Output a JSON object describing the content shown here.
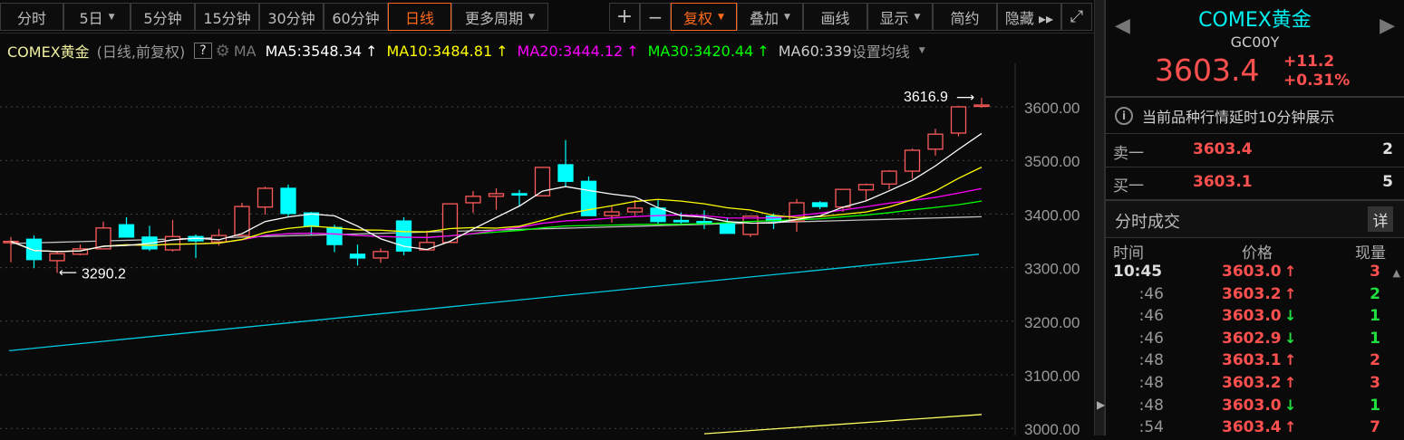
{
  "toolbar": {
    "periods": [
      {
        "label": "分时",
        "caret": false
      },
      {
        "label": "5日",
        "caret": true
      },
      {
        "label": "5分钟",
        "caret": false
      },
      {
        "label": "15分钟",
        "caret": false
      },
      {
        "label": "30分钟",
        "caret": false
      },
      {
        "label": "60分钟",
        "caret": false
      },
      {
        "label": "日线",
        "caret": false,
        "active": true
      },
      {
        "label": "更多周期",
        "caret": true
      }
    ],
    "zoom_in": "+",
    "zoom_out": "−",
    "tools": [
      {
        "label": "复权",
        "caret": true,
        "active": true
      },
      {
        "label": "叠加",
        "caret": true
      },
      {
        "label": "画线",
        "caret": false
      },
      {
        "label": "显示",
        "caret": true
      },
      {
        "label": "简约",
        "caret": false
      },
      {
        "label": "隐藏 ▸▸",
        "caret": false
      }
    ],
    "fullscreen_icon": "expand-icon"
  },
  "info": {
    "name": "COMEX黄金",
    "mode": "(日线,前复权)",
    "help": "?",
    "ma_label": "MA",
    "ma5": "MA5:3548.34",
    "ma10": "MA10:3484.81",
    "ma20": "MA20:3444.12",
    "ma30": "MA30:3420.44",
    "ma60": "MA60:339",
    "arrow": "↑",
    "set_ma": "设置均线"
  },
  "colors": {
    "up": "#ff5a5a",
    "down": "#00ffff",
    "ma5": "#ffffff",
    "ma10": "#ffff00",
    "ma20": "#ff00ff",
    "ma30": "#00ff00",
    "ma60": "#c0c0c0",
    "long1": "#00c8e0",
    "long2": "#ffff60"
  },
  "chart_data": {
    "type": "candlestick",
    "ylim": [
      2980,
      3660
    ],
    "yticks": [
      "3600.00",
      "3500.00",
      "3400.00",
      "3300.00",
      "3200.00",
      "3100.00",
      "3000.00"
    ],
    "ytick_values": [
      3600,
      3500,
      3400,
      3300,
      3200,
      3100,
      3000
    ],
    "high_label": "3616.9",
    "low_label": "3290.2",
    "ohlc": [
      [
        3348,
        3357,
        3310,
        3349
      ],
      [
        3353,
        3360,
        3299,
        3315
      ],
      [
        3313,
        3329,
        3290.2,
        3326
      ],
      [
        3325,
        3343,
        3323,
        3335
      ],
      [
        3335,
        3386,
        3335,
        3374
      ],
      [
        3380,
        3394,
        3357,
        3357
      ],
      [
        3357,
        3378,
        3331,
        3335
      ],
      [
        3333,
        3389,
        3330,
        3358
      ],
      [
        3358,
        3362,
        3318,
        3350
      ],
      [
        3348,
        3372,
        3341,
        3360
      ],
      [
        3360,
        3421,
        3357,
        3414
      ],
      [
        3413,
        3451,
        3399,
        3448
      ],
      [
        3448,
        3455,
        3396,
        3401
      ],
      [
        3402,
        3404,
        3360,
        3377
      ],
      [
        3375,
        3380,
        3329,
        3343
      ],
      [
        3325,
        3343,
        3304,
        3318
      ],
      [
        3318,
        3336,
        3309,
        3330
      ],
      [
        3387,
        3394,
        3323,
        3331
      ],
      [
        3333,
        3369,
        3333,
        3347
      ],
      [
        3347,
        3419,
        3347,
        3419
      ],
      [
        3421,
        3443,
        3402,
        3433
      ],
      [
        3433,
        3448,
        3408,
        3438
      ],
      [
        3438,
        3445,
        3414,
        3437
      ],
      [
        3434,
        3487,
        3433,
        3487
      ],
      [
        3492,
        3538,
        3451,
        3461
      ],
      [
        3461,
        3470,
        3397,
        3397
      ],
      [
        3397,
        3414,
        3384,
        3404
      ],
      [
        3404,
        3426,
        3397,
        3411
      ],
      [
        3411,
        3426,
        3380,
        3386
      ],
      [
        3388,
        3403,
        3380,
        3387
      ],
      [
        3386,
        3407,
        3372,
        3382
      ],
      [
        3382,
        3394,
        3364,
        3364
      ],
      [
        3362,
        3397,
        3357,
        3396
      ],
      [
        3396,
        3401,
        3372,
        3387
      ],
      [
        3387,
        3428,
        3367,
        3421
      ],
      [
        3421,
        3424,
        3409,
        3414
      ],
      [
        3413,
        3446,
        3404,
        3446
      ],
      [
        3445,
        3457,
        3426,
        3455
      ],
      [
        3456,
        3482,
        3446,
        3480
      ],
      [
        3480,
        3522,
        3466,
        3519
      ],
      [
        3521,
        3559,
        3509,
        3549
      ],
      [
        3551,
        3602,
        3545,
        3600
      ],
      [
        3601,
        3616.9,
        3598,
        3603.4
      ]
    ],
    "ma60_range": [
      3345,
      3395
    ],
    "long_ma_1": [
      3145,
      3325
    ],
    "long_ma_2": {
      "from_bar": 30,
      "values": [
        2990,
        3026
      ]
    }
  },
  "panel": {
    "title": "COMEX黄金",
    "code": "GC00Y",
    "price": "3603.4",
    "change": "+11.2",
    "change_pct": "+0.31%",
    "notice": "当前品种行情延时10分钟展示",
    "info_icon": "i",
    "ask_label": "卖一",
    "ask_price": "3603.4",
    "ask_vol": "2",
    "bid_label": "买一",
    "bid_price": "3603.1",
    "bid_vol": "5",
    "trades_title": "分时成交",
    "detail_btn": "详",
    "cols": {
      "time": "时间",
      "price": "价格",
      "vol": "现量"
    },
    "trades": [
      {
        "time": "10:45",
        "price": "3603.0",
        "dir": "🡑",
        "up": true,
        "vol": "3",
        "vol_up": true
      },
      {
        "time": ":46",
        "price": "3603.2",
        "dir": "🡑",
        "up": true,
        "vol": "2",
        "vol_up": false
      },
      {
        "time": ":46",
        "price": "3603.0",
        "dir": "🡓",
        "up": false,
        "vol": "1",
        "vol_up": false
      },
      {
        "time": ":46",
        "price": "3602.9",
        "dir": "🡓",
        "up": false,
        "vol": "1",
        "vol_up": false
      },
      {
        "time": ":48",
        "price": "3603.1",
        "dir": "🡑",
        "up": true,
        "vol": "2",
        "vol_up": true
      },
      {
        "time": ":48",
        "price": "3603.2",
        "dir": "🡑",
        "up": true,
        "vol": "3",
        "vol_up": true
      },
      {
        "time": ":48",
        "price": "3603.0",
        "dir": "🡓",
        "up": false,
        "vol": "1",
        "vol_up": false
      },
      {
        "time": ":54",
        "price": "3603.4",
        "dir": "🡑",
        "up": true,
        "vol": "7",
        "vol_up": true
      }
    ]
  }
}
